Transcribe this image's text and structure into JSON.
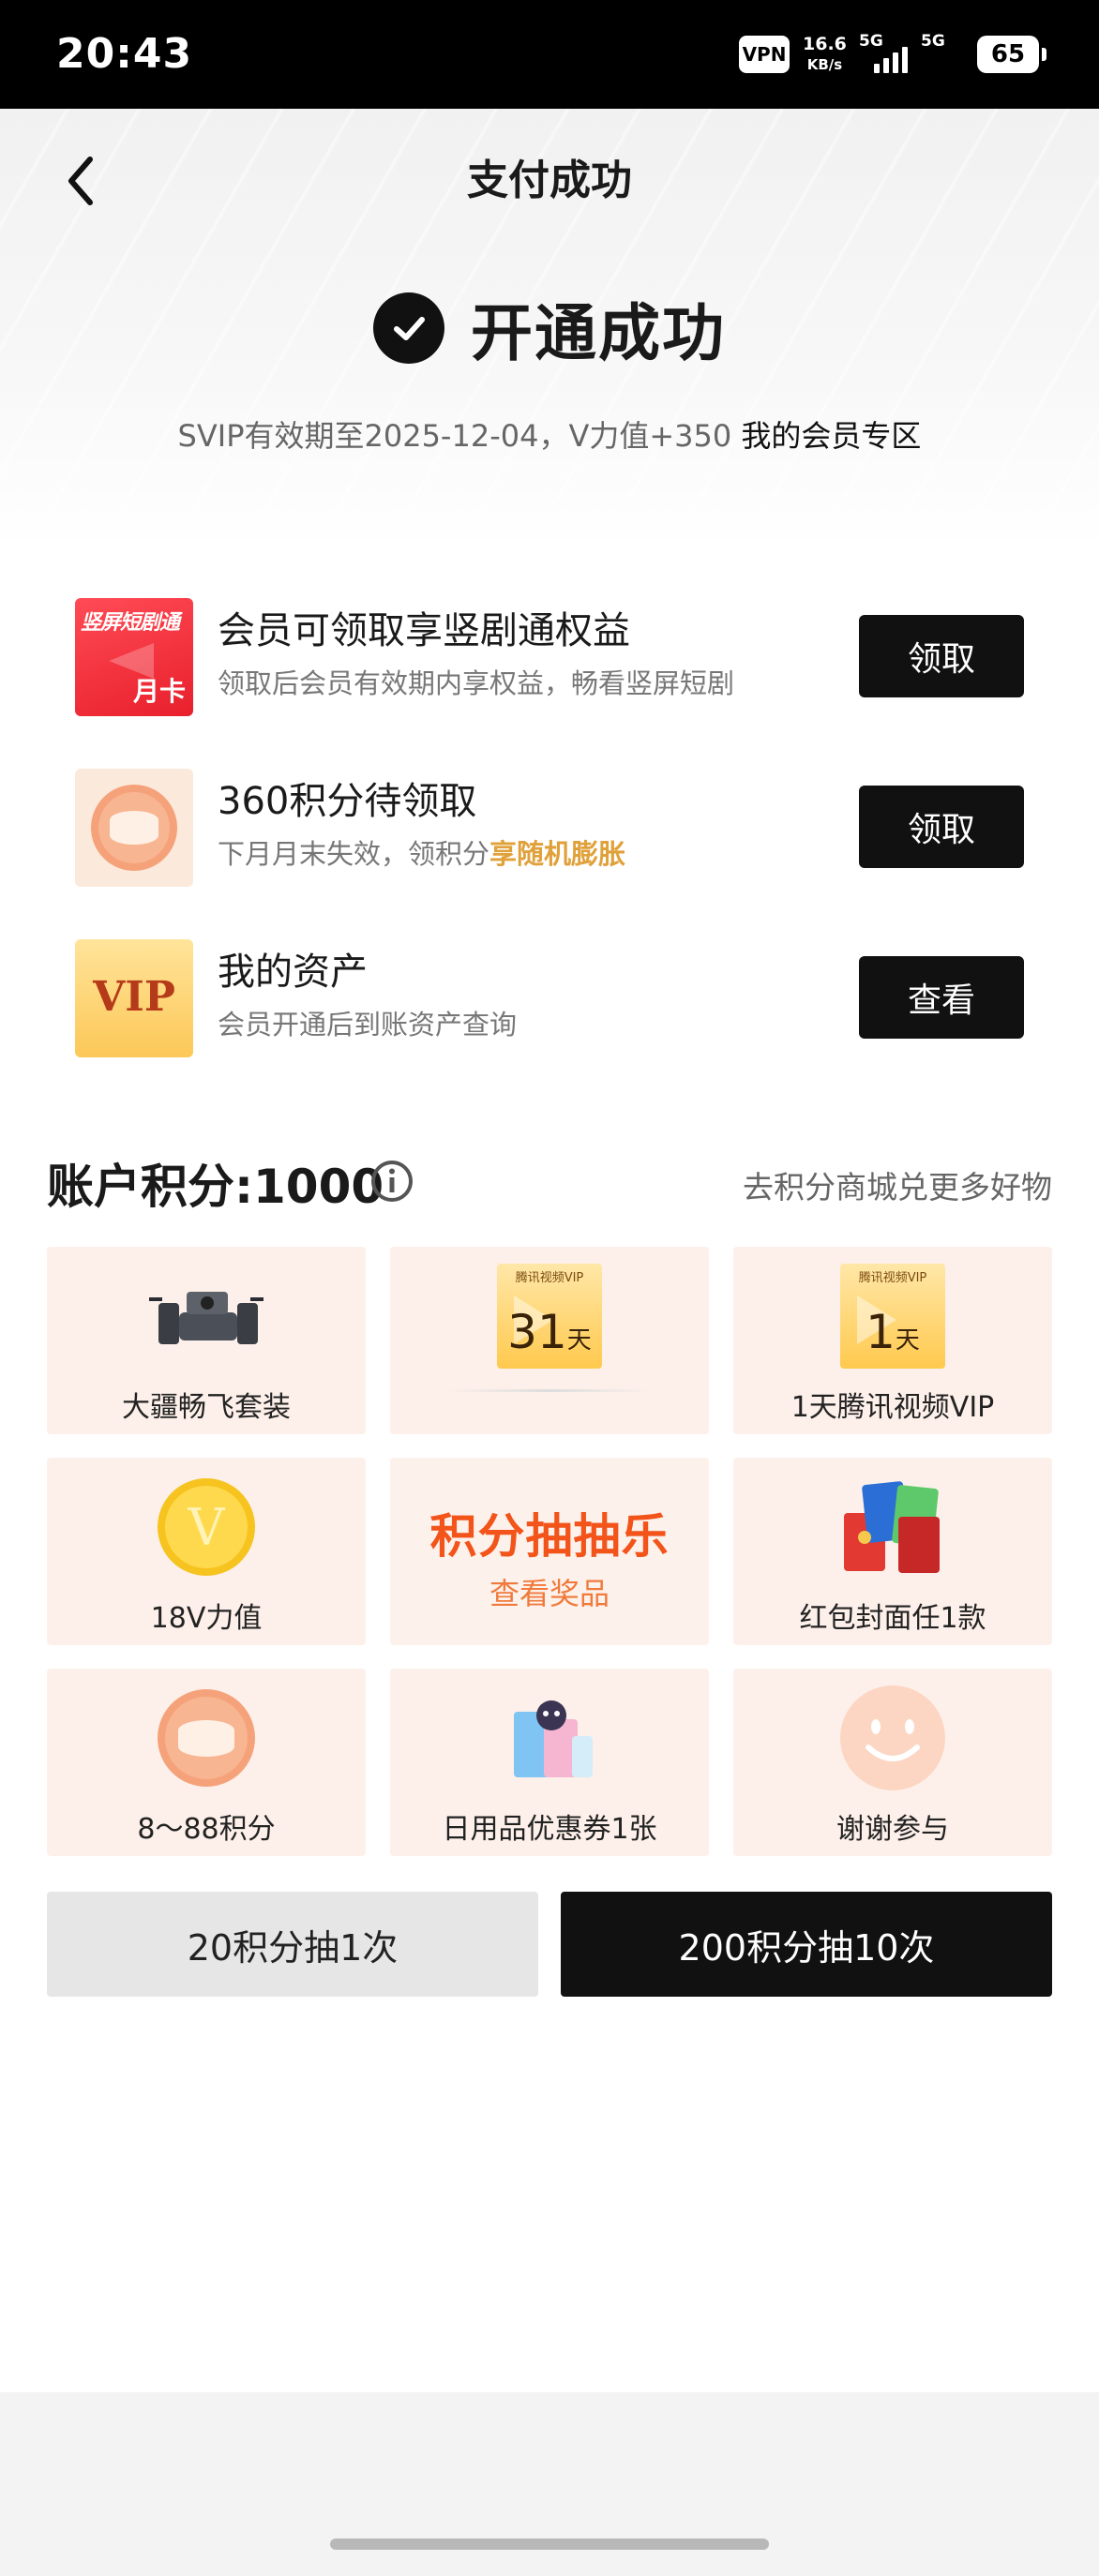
{
  "status_bar": {
    "time": "20:43",
    "vpn": "VPN",
    "speed_value": "16.6",
    "speed_unit": "KB/s",
    "net1": "5G",
    "net2": "5G",
    "battery": "65"
  },
  "header": {
    "title": "支付成功",
    "back_icon": "chevron-left-icon"
  },
  "success": {
    "text": "开通成功",
    "subtitle": "SVIP有效期至2025-12-04，V力值+350",
    "member_link": "我的会员专区"
  },
  "benefits": [
    {
      "thumb_title": "竖屏短剧通",
      "thumb_sub": "月卡",
      "title": "会员可领取享竖剧通权益",
      "desc": "领取后会员有效期内享权益，畅看竖屏短剧",
      "button": "领取"
    },
    {
      "title": "360积分待领取",
      "desc": "下月月末失效，领积分",
      "desc_highlight": "享随机膨胀",
      "button": "领取"
    },
    {
      "thumb_title": "VIP",
      "title": "我的资产",
      "desc": "会员开通后到账资产查询",
      "button": "查看"
    }
  ],
  "points": {
    "title": "账户积分:1000",
    "link": "去积分商城兑更多好物"
  },
  "prizes": [
    {
      "label": "大疆畅飞套装",
      "icon": "drone-icon"
    },
    {
      "label": "",
      "icon": "tencent-video-vip-card-icon",
      "brand": "腾讯视频VIP",
      "days": "31",
      "unit": "天"
    },
    {
      "label": "1天腾讯视频VIP",
      "icon": "tencent-video-vip-card-icon",
      "brand": "腾讯视频VIP",
      "days": "1",
      "unit": "天"
    },
    {
      "label": "18V力值",
      "icon": "v-coin-icon"
    },
    {
      "title": "积分抽抽乐",
      "sub": "查看奖品"
    },
    {
      "label": "红包封面任1款",
      "icon": "red-envelope-cover-icon"
    },
    {
      "label": "8～88积分",
      "icon": "points-coin-icon"
    },
    {
      "label": "日用品优惠券1张",
      "icon": "daily-goods-icon"
    },
    {
      "label": "谢谢参与",
      "icon": "smile-face-icon"
    }
  ],
  "draw": {
    "one": "20积分抽1次",
    "ten": "200积分抽10次"
  }
}
